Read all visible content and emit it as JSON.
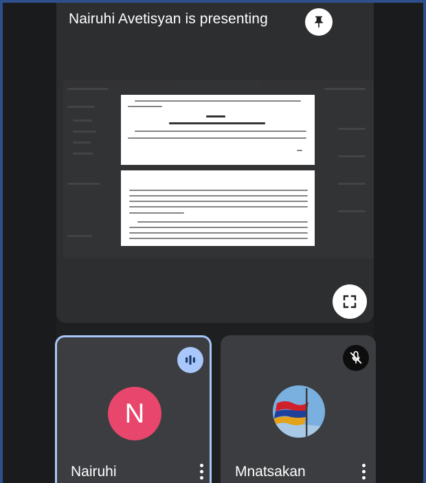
{
  "presentation": {
    "presenter_name": "Nairuhi Avetisyan",
    "title": "Nairuhi Avetisyan is presenting",
    "pin_icon": "pin-icon",
    "fullscreen_icon": "fullscreen-icon"
  },
  "participants": [
    {
      "name": "Nairuhi",
      "avatar_letter": "N",
      "avatar_color": "#e8466c",
      "status": "speaking",
      "status_icon": "audio-levels-icon",
      "more_icon": "more-vert-icon"
    },
    {
      "name": "Mnatsakan",
      "avatar": "flag-avatar",
      "status": "muted",
      "status_icon": "mic-off-icon",
      "more_icon": "more-vert-icon"
    }
  ],
  "colors": {
    "accent": "#a8c7fa",
    "tile_bg": "#3c3d40",
    "presentation_bg": "#2d2e30",
    "frame": "#2f4f8c"
  }
}
